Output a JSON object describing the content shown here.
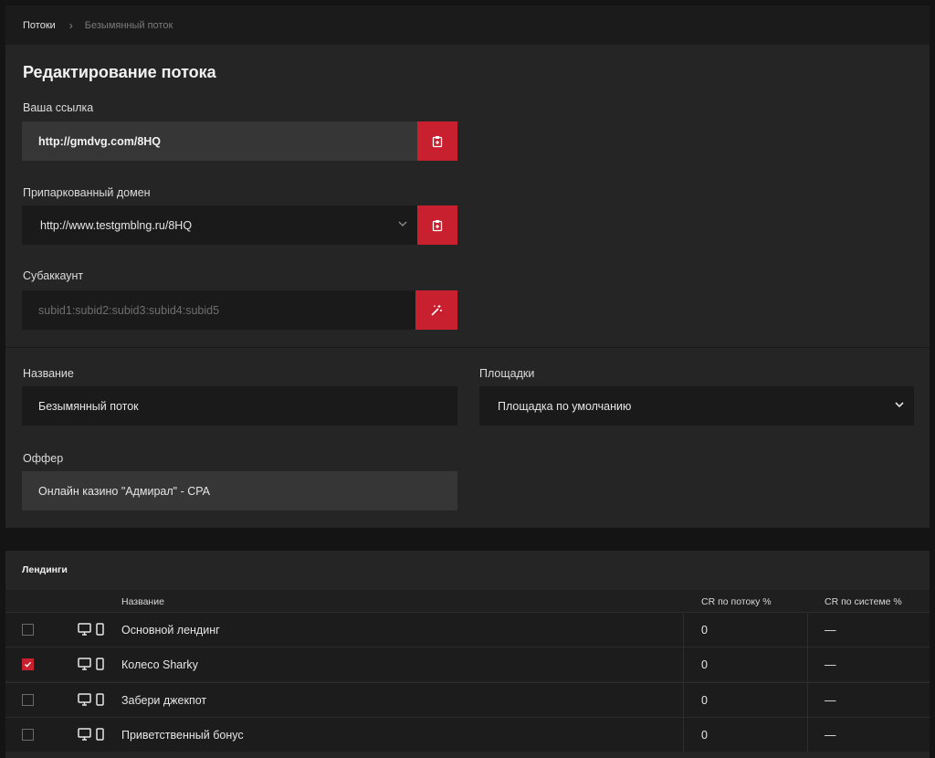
{
  "breadcrumb": {
    "root": "Потоки",
    "separator": "›",
    "current": "Безымянный поток"
  },
  "editor": {
    "title": "Редактирование потока",
    "link": {
      "label": "Ваша ссылка",
      "value": "http://gmdvg.com/8HQ",
      "button_icon": "clipboard-icon"
    },
    "domain": {
      "label": "Припаркованный домен",
      "value": "http://www.testgmblng.ru/8HQ",
      "button_icon": "clipboard-icon"
    },
    "subaccount": {
      "label": "Субаккаунт",
      "placeholder": "subid1:subid2:subid3:subid4:subid5",
      "button_icon": "magic-wand-icon"
    },
    "name": {
      "label": "Название",
      "value": "Безымянный поток"
    },
    "platforms": {
      "label": "Площадки",
      "value": "Площадка по умолчанию"
    },
    "offer": {
      "label": "Оффер",
      "value": "Онлайн казино \"Адмирал\" - CPA"
    }
  },
  "landings": {
    "title": "Лендинги",
    "columns": {
      "name": "Название",
      "cr_stream": "CR по потоку %",
      "cr_system": "CR по системе %"
    },
    "rows": [
      {
        "checked": false,
        "name": "Основной лендинг",
        "cr_stream": "0",
        "cr_system": "—"
      },
      {
        "checked": true,
        "name": "Колесо Sharky",
        "cr_stream": "0",
        "cr_system": "—"
      },
      {
        "checked": false,
        "name": "Забери джекпот",
        "cr_stream": "0",
        "cr_system": "—"
      },
      {
        "checked": false,
        "name": "Приветственный бонус",
        "cr_stream": "0",
        "cr_system": "—"
      }
    ]
  },
  "colors": {
    "accent": "#c8202f",
    "panel": "#252525",
    "input": "#1a1a1a",
    "background": "#141414"
  }
}
